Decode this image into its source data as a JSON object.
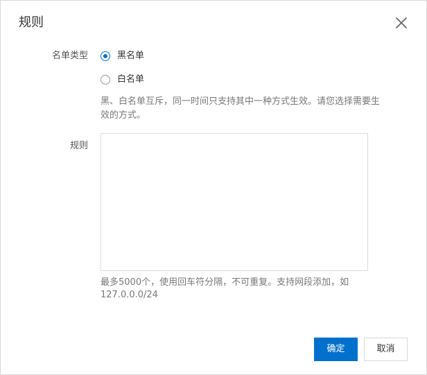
{
  "dialog": {
    "title": "规则",
    "close_icon": "close-icon"
  },
  "list_type": {
    "label": "名单类型",
    "options": [
      {
        "label": "黑名单",
        "checked": true
      },
      {
        "label": "白名单",
        "checked": false
      }
    ],
    "help_line1": "黑、白名单互斥，同一时间只支持其中一种方式生效。请您选择需要生",
    "help_line2": "效的方式。"
  },
  "rules": {
    "label": "规则",
    "value": "",
    "help_line1": "最多5000个，使用回车符分隔，不可重复。支持网段添加，如",
    "help_line2": "127.0.0.0/24"
  },
  "footer": {
    "confirm_label": "确定",
    "cancel_label": "取消"
  },
  "colors": {
    "accent": "#0070cc",
    "border": "#d9d9d9"
  }
}
